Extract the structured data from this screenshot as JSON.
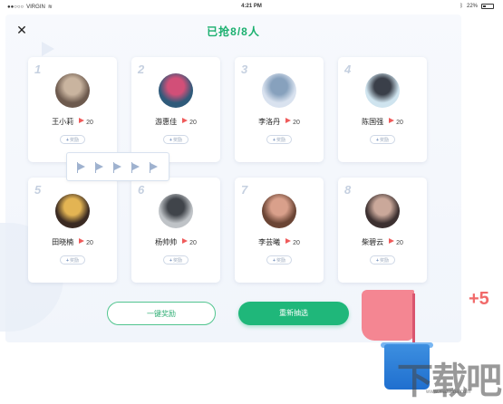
{
  "status_bar": {
    "carrier": "VIRGIN",
    "time": "4:21 PM",
    "battery": "22%"
  },
  "header": {
    "title": "已抢8/8人"
  },
  "reward_label": "奖励",
  "students": [
    {
      "index": "1",
      "name": "王小莉",
      "score": "20",
      "avatar": [
        "#6d5a4e",
        "#c9b49f"
      ]
    },
    {
      "index": "2",
      "name": "游惠佳",
      "score": "20",
      "avatar": [
        "#2f5a7a",
        "#d24f78"
      ]
    },
    {
      "index": "3",
      "name": "李洛丹",
      "score": "20",
      "avatar": [
        "#d9e2ef",
        "#87a1bd"
      ]
    },
    {
      "index": "4",
      "name": "陈国强",
      "score": "20",
      "avatar": [
        "#cfe4ef",
        "#3a3f49"
      ]
    },
    {
      "index": "5",
      "name": "田晓楠",
      "score": "20",
      "avatar": [
        "#3a2a22",
        "#e3b453"
      ]
    },
    {
      "index": "6",
      "name": "杨帅帅",
      "score": "20",
      "avatar": [
        "#bfc3c7",
        "#40444a"
      ]
    },
    {
      "index": "7",
      "name": "李芸曦",
      "score": "20",
      "avatar": [
        "#6b4535",
        "#d9a08b"
      ]
    },
    {
      "index": "8",
      "name": "柴碧云",
      "score": "20",
      "avatar": [
        "#3c3030",
        "#caa89a"
      ]
    }
  ],
  "actions": {
    "reward_all": "一键奖励",
    "reselect": "重新抽选"
  },
  "overlay": {
    "plus": "+5",
    "watermark": "下载吧",
    "watermark_url": "www.xiazaiba.com"
  },
  "colors": {
    "accent": "#1fb77a",
    "flag": "#ef5b5b"
  }
}
